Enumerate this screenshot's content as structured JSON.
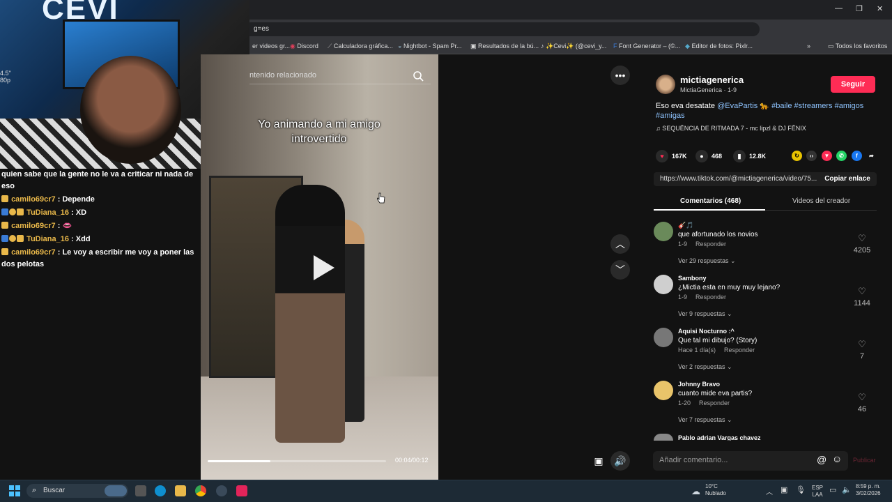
{
  "browser": {
    "address_partial": "g=es",
    "bookmarks": [
      "er videos gr...",
      "Discord",
      "Calculadora gráfica...",
      "Nightbot - Spam Pr...",
      "Resultados de la bú...",
      "✨Cevi✨ (@cevi_y...",
      "Font Generator – (©...",
      "Editor de fotos: Pixlr...",
      "Todos los favoritos"
    ]
  },
  "webcam": {
    "logo": "CEVI",
    "fps": "4.5\"\n80p"
  },
  "chat": {
    "messages": [
      {
        "user": "",
        "text": "quien sabe que la gente no le va a criticar ni nada de eso"
      },
      {
        "user": "camilo69cr7",
        "text": " : Depende"
      },
      {
        "user": "TuDiana_16",
        "text": " : XD"
      },
      {
        "user": "camilo69cr7",
        "text": " : 👄"
      },
      {
        "user": "TuDiana_16",
        "text": " : Xdd"
      },
      {
        "user": "camilo69cr7",
        "text": " : Le voy a escribir me voy a poner las dos pelotas"
      }
    ]
  },
  "video": {
    "search_placeholder": "ntenido relacionado",
    "caption": "Yo animando a mi amigo introvertido",
    "time": "00:04/00:12",
    "progress": 0.35
  },
  "post": {
    "username": "mictiagenerica",
    "subline": "MictiaGenerica · 1-9",
    "follow": "Seguir",
    "desc_text": "Eso eva desatate ",
    "mention": "@EvaPartis",
    "emoji": " 🐆 ",
    "tags": "#baile #streamers #amigos #amigas",
    "music": "SEQUÊNCIA DE RITMADA 7 - mc lipzl & DJ FÊNIX",
    "likes": "167K",
    "comments": "468",
    "saves": "12.8K",
    "link": "https://www.tiktok.com/@mictiagenerica/video/75...",
    "copy": "Copiar enlace",
    "tab_comments": "Comentarios (468)",
    "tab_creator": "Videos del creador",
    "comment_placeholder": "Añadir comentario...",
    "publish": "Publicar"
  },
  "comments": [
    {
      "name": "🎸🎵",
      "text": "que afortunado los novios",
      "date": "1-9",
      "reply": "Responder",
      "likes": "4205",
      "replies": "Ver 29 respuestas ⌄",
      "avatar": "#6a8a5a"
    },
    {
      "name": "Sambony",
      "text": "¿Mictia esta en muy muy lejano?",
      "date": "1-9",
      "reply": "Responder",
      "likes": "1144",
      "replies": "Ver 9 respuestas ⌄",
      "avatar": "#cfcfcf"
    },
    {
      "name": "Aquisi Nocturno :^",
      "text": "Que tal mi dibujo? (Story)",
      "date": "Hace 1 día(s)",
      "reply": "Responder",
      "likes": "7",
      "replies": "Ver 2 respuestas ⌄",
      "avatar": "#777"
    },
    {
      "name": "Johnny Bravo",
      "text": "cuanto mide eva partis?",
      "date": "1-20",
      "reply": "Responder",
      "likes": "46",
      "replies": "Ver 7 respuestas ⌄",
      "avatar": "#e9c46a"
    },
    {
      "name": "Pablo adrian Vargas chavez",
      "text": "",
      "date": "",
      "reply": "",
      "likes": "",
      "replies": "",
      "avatar": "#888"
    }
  ],
  "taskbar": {
    "search": "Buscar",
    "temp": "10°C",
    "weather": "Nublado",
    "lang1": "ESP",
    "lang2": "LAA",
    "time": "8:59 p. m.",
    "date": "3/02/2026"
  }
}
